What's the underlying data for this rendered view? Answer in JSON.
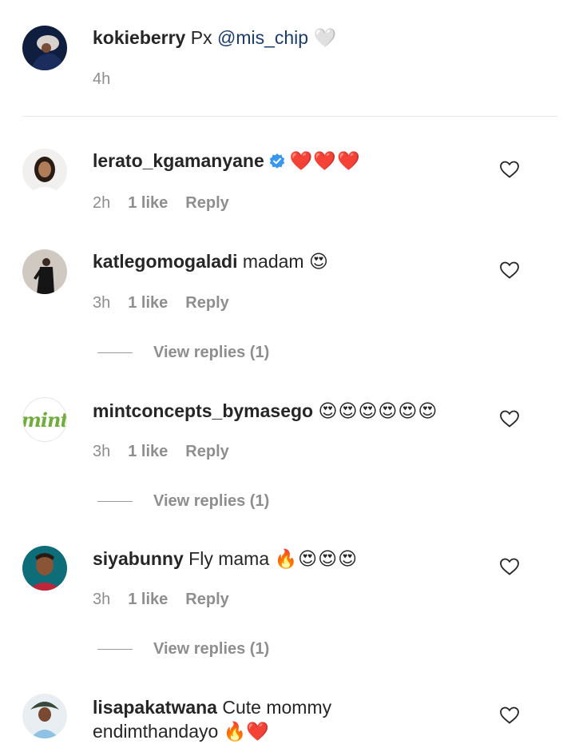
{
  "comments": [
    {
      "username": "kokieberry",
      "text_prefix": "Px ",
      "mention": "@mis_chip",
      "emoji": "🤍",
      "time": "4h",
      "likes": "",
      "reply": ""
    },
    {
      "username": "lerato_kgamanyane",
      "verified": true,
      "emoji": "❤️❤️❤️",
      "time": "2h",
      "likes": "1 like",
      "reply": "Reply"
    },
    {
      "username": "katlegomogaladi",
      "text": "madam",
      "emoji": "😍",
      "time": "3h",
      "likes": "1 like",
      "reply": "Reply",
      "view_replies": "View replies (1)"
    },
    {
      "username": "mintconcepts_bymasego",
      "avatar_text": "mint",
      "emoji": "😍😍😍😍😍😍",
      "time": "3h",
      "likes": "1 like",
      "reply": "Reply",
      "view_replies": "View replies (1)"
    },
    {
      "username": "siyabunny",
      "text": "Fly mama",
      "emoji": "🔥😍😍😍",
      "time": "3h",
      "likes": "1 like",
      "reply": "Reply",
      "view_replies": "View replies (1)"
    },
    {
      "username": "lisapakatwana",
      "text": "Cute mommy endimthandayo",
      "emoji": "🔥❤️"
    }
  ],
  "colors": {
    "text": "#262626",
    "meta": "#8e8e8e",
    "mention": "#1a3c6e",
    "verified": "#3897f0",
    "mint_brand": "#6fae3c"
  },
  "icons": {
    "like": "heart-outline-icon",
    "verified": "verified-badge-icon"
  }
}
